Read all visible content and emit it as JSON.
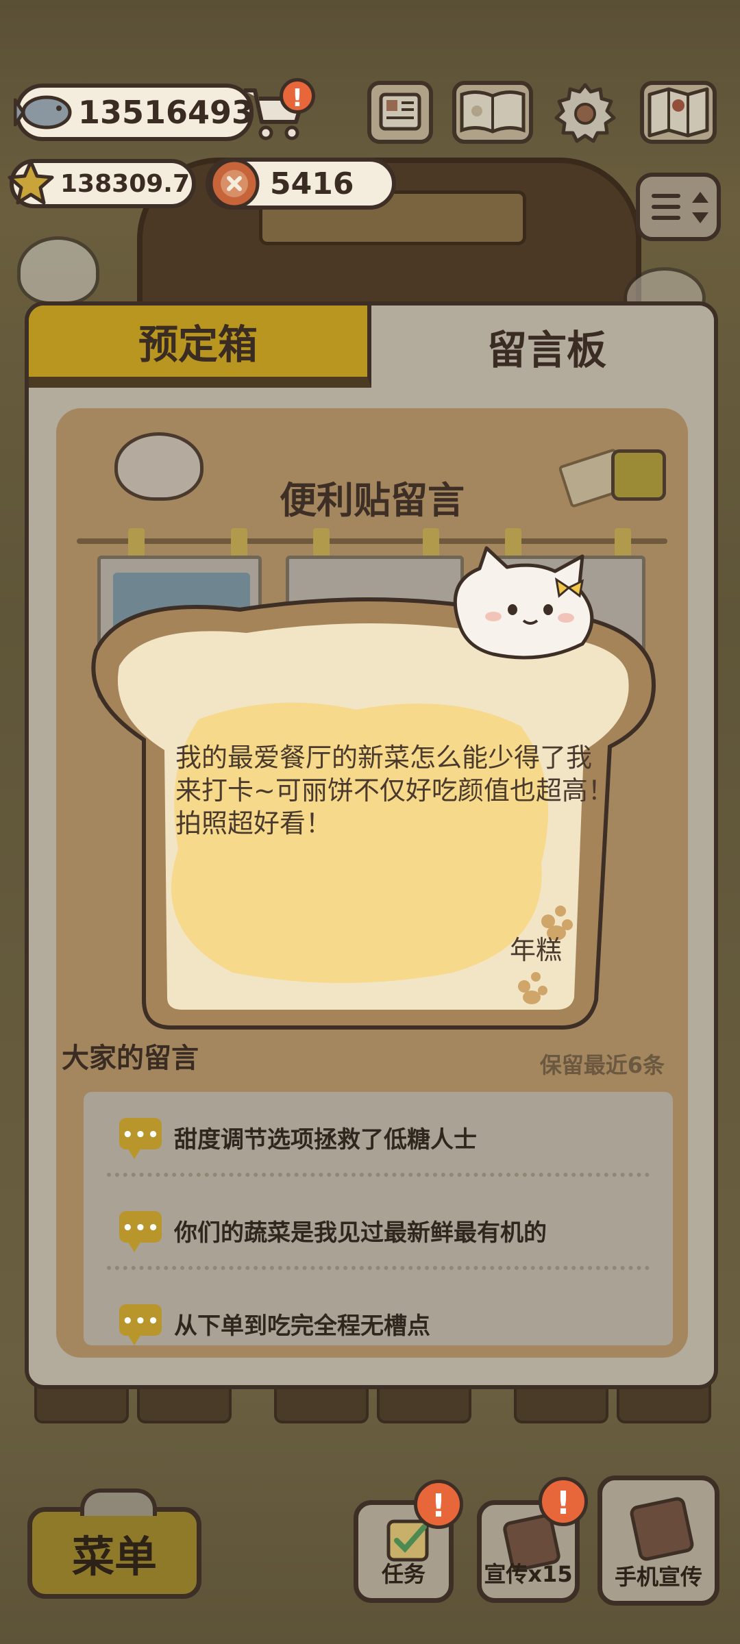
{
  "hud": {
    "fish_value": "13516493",
    "star_value": "138309.7",
    "coin_value": "5416",
    "alert_mark": "!",
    "icons": [
      "fish-icon",
      "shopping-cart-icon",
      "star-icon",
      "coin-icon",
      "newspaper-icon",
      "recipe-book-icon",
      "settings-gear-icon",
      "map-icon",
      "sort-toggle-icon"
    ]
  },
  "modal": {
    "tabs": [
      {
        "label": "预定箱",
        "active": false
      },
      {
        "label": "留言板",
        "active": true
      }
    ],
    "board_title": "便利贴留言",
    "featured_note": {
      "text": "我的最爱餐厅的新菜怎么能少得了我来打卡~可丽饼不仅好吃颜值也超高！拍照超好看！",
      "author": "年糕"
    },
    "comments_title": "大家的留言",
    "comments_hint": "保留最近6条",
    "comments": [
      "甜度调节选项拯救了低糖人士",
      "你们的蔬菜是我见过最新鲜最有机的",
      "从下单到吃完全程无槽点"
    ]
  },
  "bottom_bar": {
    "menu_label": "菜单",
    "task_label": "任务",
    "promo_label": "宣传x15",
    "phone_promo_label": "手机宣传",
    "alert_mark": "!"
  },
  "colors": {
    "outline": "#3d2f25",
    "gold_tab": "#b8961f",
    "alert": "#e8673a",
    "toast_crust": "#a5845a",
    "toast_inner": "#f2e5c6",
    "butter": "#f6d98a"
  }
}
